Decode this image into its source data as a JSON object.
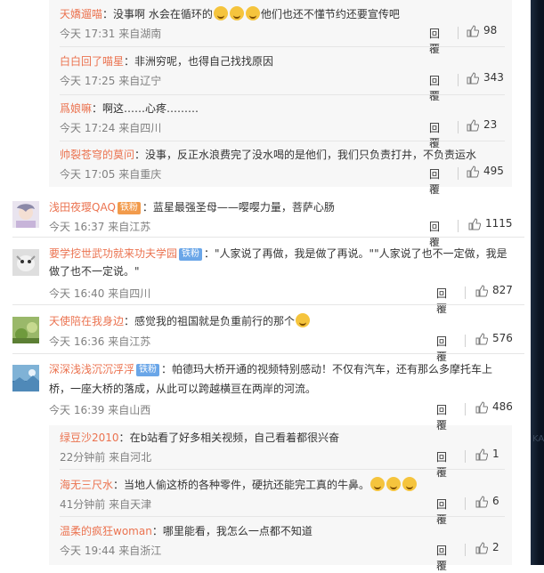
{
  "icons": {
    "like": "thumb-up-icon",
    "emoji": "emoji-icon"
  },
  "colors": {
    "username": "#eb7350",
    "text": "#333333",
    "meta": "#808080",
    "nested_bg": "#f7f7f7",
    "fan_badge": "#6aa6e8"
  },
  "reply_label": "回覆",
  "nested_top": [
    {
      "user": "天嬌遛喵",
      "colon": "：",
      "text": "没事啊 水会在循环的",
      "text2": "他们也还不懂节约还要宣传吧",
      "time": "今天 17:31 来自湖南",
      "likes": "98",
      "emoji_count": 3
    },
    {
      "user": "白白回了喵星",
      "colon": "：",
      "text": "非洲穷呢，也得自己找找原因",
      "time": "今天 17:25 来自辽宁",
      "likes": "343"
    },
    {
      "user": "爲娘嘛",
      "colon": "：",
      "text": "啊这……心疼………",
      "time": "今天 17:24 来自四川",
      "likes": "23"
    },
    {
      "user": "帅裂苍穹的莫问",
      "colon": "：",
      "text": "没事，反正水浪费完了没水喝的是他们，我们只负责打井，不负责运水",
      "time": "今天 17:05 来自重庆",
      "likes": "495"
    }
  ],
  "comments": [
    {
      "user": "浅田夜璎QAQ",
      "badge": "铁粉",
      "colon": "：",
      "text": "蓝星最强圣母——嘤嘤力量，菩萨心肠",
      "time": "今天 16:37 来自江苏",
      "likes": "1115"
    },
    {
      "user": "要学挖世武功就来功夫学园",
      "badge": "铁粉",
      "colon": "：",
      "text": "\"人家说了再做，我是做了再说。\"\"人家说了也不一定做，我是",
      "text2": "做了也不一定说。\"",
      "time": "今天 16:40 来自四川",
      "likes": "827"
    },
    {
      "user": "天使陪在我身边",
      "colon": "：",
      "text": "感觉我的祖国就是负重前行的那个",
      "time": "今天 16:36 来自江苏",
      "likes": "576"
    },
    {
      "user": "深深浅浅沉沉浮浮",
      "badge": "铁粉",
      "colon": "：",
      "text": "帕德玛大桥开通的视频特别感动！不仅有汽车，还有那么多摩托车上",
      "text2": "桥，一座大桥的落成，从此可以跨越横亘在两岸的河流。",
      "time": "今天 16:39 来自山西",
      "likes": "486"
    }
  ],
  "nested_bottom": [
    {
      "user": "绿豆沙2010",
      "colon": "：",
      "text": "在b站看了好多相关视频，自己看着都很兴奋",
      "time": "22分钟前 来自河北",
      "likes": "1"
    },
    {
      "user": "海无三尺水",
      "colon": "：",
      "text": "当地人偷这桥的各种零件，硬抗还能完工真的牛鼻。",
      "time": "41分钟前 来自天津",
      "likes": "6"
    },
    {
      "user": "温柔的疯狂woman",
      "colon": "：",
      "text": "哪里能看，我怎么一点都不知道",
      "time": "今天 19:44 来自浙江",
      "likes": "2"
    }
  ],
  "edge_ghost": "KAG"
}
